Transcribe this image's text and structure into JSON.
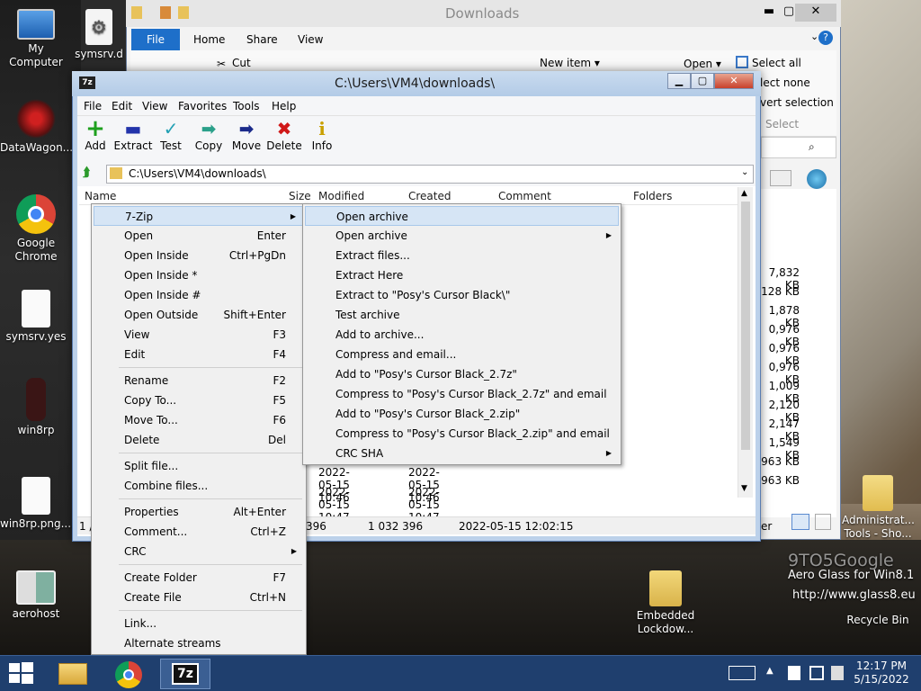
{
  "desktop": {
    "icons": [
      {
        "name": "My Computer",
        "icon": "computer-icon"
      },
      {
        "name": "symsrv.d",
        "icon": "gear-file-icon"
      },
      {
        "name": "DataWagon...",
        "icon": "shortcut-icon"
      },
      {
        "name": "Google Chrome",
        "icon": "chrome-icon"
      },
      {
        "name": "symsrv.yes",
        "icon": "file-icon"
      },
      {
        "name": "win8rp",
        "icon": "app-icon"
      },
      {
        "name": "win8rp.png....",
        "icon": "file-icon"
      },
      {
        "name": "aerohost",
        "icon": "window-icon"
      },
      {
        "name": "Embedded Lockdow...",
        "icon": "lock-folder-icon"
      },
      {
        "name": "Administrat... Tools - Sho...",
        "icon": "folder-icon"
      },
      {
        "name": "Recycle Bin",
        "icon": "recycle-bin-icon"
      }
    ],
    "watermark": "9TO5Google",
    "aero_line1": "Aero Glass for Win8.1",
    "aero_line2": "http://www.glass8.eu"
  },
  "taskbar": {
    "time": "12:17 PM",
    "date": "5/15/2022",
    "apps": [
      "file-explorer-icon",
      "chrome-icon",
      "7zip-icon"
    ]
  },
  "explorer": {
    "title": "Downloads",
    "tabs": [
      "File",
      "Home",
      "Share",
      "View"
    ],
    "buttons": {
      "cut": "Cut",
      "new_item": "New item ▾",
      "open": "Open ▾",
      "select_all": "Select all",
      "select_none": "lect none",
      "invert": "vert selection",
      "select": "Select"
    },
    "sizes": [
      "7,832 KB",
      "128 KB",
      "1,878 KB",
      "0,976 KB",
      "0,976 KB",
      "0,976 KB",
      "1,009 KB",
      "2,120 KB",
      "2,147 KB",
      "1,549 KB",
      "963 KB",
      "963 KB"
    ],
    "status_fragment": "er"
  },
  "sevenzip": {
    "title": "C:\\Users\\VM4\\downloads\\",
    "menu": [
      "File",
      "Edit",
      "View",
      "Favorites",
      "Tools",
      "Help"
    ],
    "toolbar": [
      {
        "label": "Add",
        "icon": "add-icon",
        "glyph": "+",
        "color": "#1ea01e"
      },
      {
        "label": "Extract",
        "icon": "extract-icon",
        "glyph": "▬",
        "color": "#2233aa"
      },
      {
        "label": "Test",
        "icon": "test-icon",
        "glyph": "✓",
        "color": "#22a0b4"
      },
      {
        "label": "Copy",
        "icon": "copy-arrow-icon",
        "glyph": "➡",
        "color": "#2aa08a"
      },
      {
        "label": "Move",
        "icon": "move-arrow-icon",
        "glyph": "➡",
        "color": "#1a2a8a"
      },
      {
        "label": "Delete",
        "icon": "delete-icon",
        "glyph": "✖",
        "color": "#d01818"
      },
      {
        "label": "Info",
        "icon": "info-icon",
        "glyph": "i",
        "color": "#c9a000"
      }
    ],
    "address": "C:\\Users\\VM4\\downloads\\",
    "columns": [
      "Name",
      "Size",
      "Modified",
      "Created",
      "Comment",
      "Folders"
    ],
    "visible_rows": [
      {
        "modified": "2022-05-15 10:46",
        "created": "2022-05-15 10:46"
      },
      {
        "modified": "2022-05-15 10:47",
        "created": "2022-05-15 10:47"
      }
    ],
    "status": {
      "left": "1 /",
      "size1": "396",
      "size2": "1 032 396",
      "date": "2022-05-15 12:02:15"
    }
  },
  "context_menu": {
    "items": [
      {
        "label": "7-Zip",
        "shortcut": "",
        "submenu": true,
        "highlight": true
      },
      {
        "label": "Open",
        "shortcut": "Enter"
      },
      {
        "label": "Open Inside",
        "shortcut": "Ctrl+PgDn"
      },
      {
        "label": "Open Inside *",
        "shortcut": ""
      },
      {
        "label": "Open Inside #",
        "shortcut": ""
      },
      {
        "label": "Open Outside",
        "shortcut": "Shift+Enter"
      },
      {
        "label": "View",
        "shortcut": "F3"
      },
      {
        "label": "Edit",
        "shortcut": "F4"
      },
      {
        "label": "Rename",
        "shortcut": "F2"
      },
      {
        "label": "Copy To...",
        "shortcut": "F5"
      },
      {
        "label": "Move To...",
        "shortcut": "F6"
      },
      {
        "label": "Delete",
        "shortcut": "Del"
      },
      {
        "label": "Split file...",
        "shortcut": ""
      },
      {
        "label": "Combine files...",
        "shortcut": ""
      },
      {
        "label": "Properties",
        "shortcut": "Alt+Enter"
      },
      {
        "label": "Comment...",
        "shortcut": "Ctrl+Z"
      },
      {
        "label": "CRC",
        "shortcut": "",
        "submenu": true
      },
      {
        "label": "Create Folder",
        "shortcut": "F7"
      },
      {
        "label": "Create File",
        "shortcut": "Ctrl+N"
      },
      {
        "label": "Link...",
        "shortcut": ""
      },
      {
        "label": "Alternate streams",
        "shortcut": ""
      }
    ]
  },
  "submenu": {
    "items": [
      {
        "label": "Open archive",
        "highlight": true
      },
      {
        "label": "Open archive",
        "submenu": true
      },
      {
        "label": "Extract files..."
      },
      {
        "label": "Extract Here"
      },
      {
        "label": "Extract to \"Posy's Cursor Black\\\""
      },
      {
        "label": "Test archive"
      },
      {
        "label": "Add to archive..."
      },
      {
        "label": "Compress and email..."
      },
      {
        "label": "Add to \"Posy's Cursor Black_2.7z\""
      },
      {
        "label": "Compress to \"Posy's Cursor Black_2.7z\" and email"
      },
      {
        "label": "Add to \"Posy's Cursor Black_2.zip\""
      },
      {
        "label": "Compress to \"Posy's Cursor Black_2.zip\" and email"
      },
      {
        "label": "CRC SHA",
        "submenu": true
      }
    ]
  }
}
